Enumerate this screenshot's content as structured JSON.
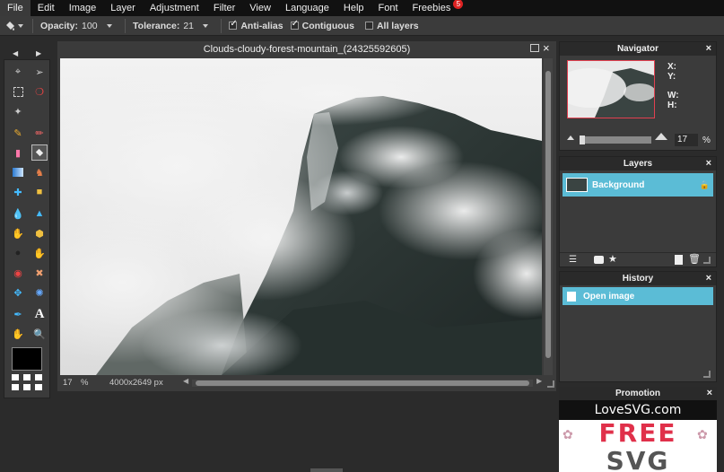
{
  "menu": {
    "items": [
      "File",
      "Edit",
      "Image",
      "Layer",
      "Adjustment",
      "Filter",
      "View",
      "Language",
      "Help",
      "Font",
      "Freebies"
    ],
    "freebies_badge": "5"
  },
  "options": {
    "opacity_label": "Opacity:",
    "opacity_value": "100",
    "tolerance_label": "Tolerance:",
    "tolerance_value": "21",
    "antialias_label": "Anti-alias",
    "contiguous_label": "Contiguous",
    "alllayers_label": "All layers"
  },
  "document": {
    "title": "Clouds-cloudy-forest-mountain_(24325592605)",
    "zoom": "17",
    "zoom_unit": "%",
    "dimensions": "4000x2649 px"
  },
  "navigator": {
    "title": "Navigator",
    "x_label": "X:",
    "y_label": "Y:",
    "w_label": "W:",
    "h_label": "H:",
    "zoom": "17",
    "zoom_unit": "%"
  },
  "layers": {
    "title": "Layers",
    "items": [
      {
        "name": "Background"
      }
    ]
  },
  "history": {
    "title": "History",
    "items": [
      {
        "name": "Open image"
      }
    ]
  },
  "promotion": {
    "title": "Promotion",
    "brand": "LoveSVG.com",
    "headline": "FREE",
    "subline": "SVG"
  },
  "colors": {
    "accent": "#5bbcd6",
    "menu_bg": "#111111",
    "panel_bg": "#3b3b3b",
    "badge": "#dd2222",
    "promo_red": "#e0304a"
  }
}
